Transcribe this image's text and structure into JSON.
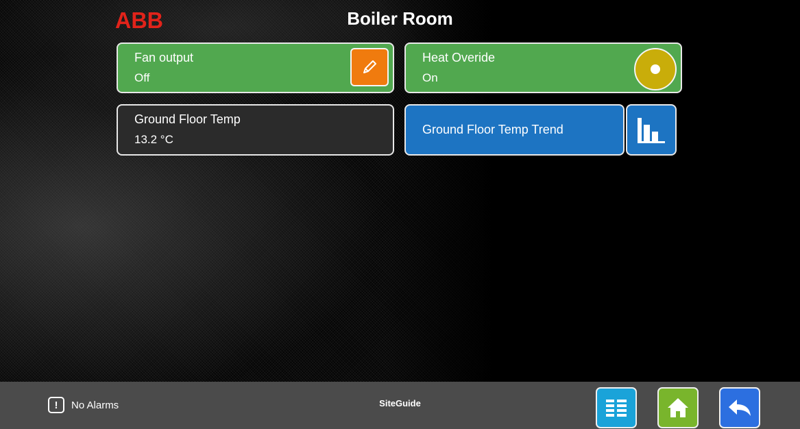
{
  "header": {
    "logo_text": "ABB",
    "title": "Boiler Room"
  },
  "tiles": {
    "fan": {
      "label": "Fan output",
      "value": "Off"
    },
    "heat": {
      "label": "Heat Overide",
      "value": "On"
    },
    "temp": {
      "label": "Ground Floor Temp",
      "value": "13.2 °C"
    },
    "trend": {
      "label": "Ground Floor Temp Trend"
    }
  },
  "footer": {
    "alarm_text": "No Alarms",
    "site_guide": "SiteGuide"
  },
  "icons": {
    "edit": "pencil-icon",
    "toggle": "toggle-icon",
    "trend": "bar-chart-icon",
    "alarm": "exclamation-icon",
    "list": "list-icon",
    "home": "home-icon",
    "back": "back-arrow-icon"
  },
  "colors": {
    "tile_green": "#51a84f",
    "tile_dark": "#2b2b2b",
    "tile_blue": "#1d74c2",
    "edit_orange": "#f07b0e",
    "toggle_yellow": "#c9ad0a",
    "logo_red": "#e2231a"
  }
}
